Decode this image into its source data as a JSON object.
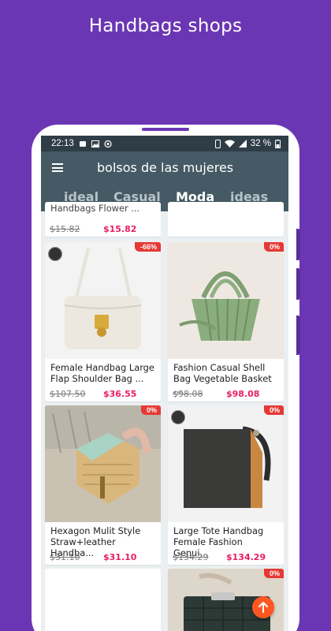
{
  "promo": {
    "title": "Handbags shops"
  },
  "status": {
    "time": "22:13",
    "battery": "32 %"
  },
  "appbar": {
    "title": "bolsos de las mujeres"
  },
  "tabs": [
    {
      "label": "ideal"
    },
    {
      "label": "Casual"
    },
    {
      "label": "Moda"
    },
    {
      "label": "ideas"
    }
  ],
  "active_tab": "Moda",
  "products": [
    {
      "name": "Handbags Flower ...",
      "old_price": "$15.82",
      "price": "$15.82",
      "discount": ""
    },
    {
      "name": "Female Handbag Large\nFlap Shoulder Bag ...",
      "old_price": "$107.50",
      "price": "$36.55",
      "discount": "-66%"
    },
    {
      "name": "Fashion Casual Shell\nBag Vegetable Basket ...",
      "old_price": "$98.08",
      "price": "$98.08",
      "discount": "0%"
    },
    {
      "name": "Hexagon Mulit Style\nStraw+leather Handba...",
      "old_price": "$31.10",
      "price": "$31.10",
      "discount": "0%"
    },
    {
      "name": "Large Tote Handbag\nFemale Fashion Genui...",
      "old_price": "$134.29",
      "price": "$134.29",
      "discount": "0%"
    },
    {
      "name": "",
      "old_price": "",
      "price": "",
      "discount": "0%"
    }
  ],
  "colors": {
    "background": "#6b36b4",
    "appbar": "#455a64",
    "statusbar": "#2f3d46",
    "price": "#e91e63",
    "discount_badge": "#e53935",
    "fab": "#ff5722"
  },
  "icons": {
    "menu": "hamburger-icon",
    "fab": "arrow-up-icon"
  }
}
